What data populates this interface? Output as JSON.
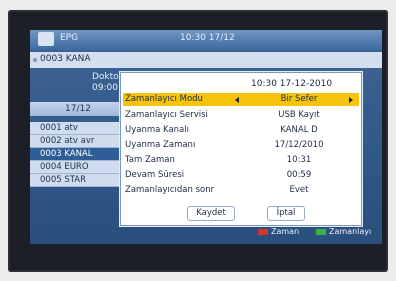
{
  "epg": {
    "title": "EPG",
    "time": "10:30 17/12",
    "event_text": "0003 KANA",
    "detail_line1": "Dokto",
    "detail_line2": "09:00",
    "date": "17/12",
    "channels": [
      {
        "label": "0001 atv",
        "selected": false
      },
      {
        "label": "0002 atv avr",
        "selected": false
      },
      {
        "label": "0003 KANAL",
        "selected": true
      },
      {
        "label": "0004 EURO",
        "selected": false
      },
      {
        "label": "0005 STAR",
        "selected": false
      }
    ],
    "legend": {
      "red_label": "Zaman",
      "green_label": "Zamanlayı",
      "red_color": "#d9342a",
      "green_color": "#39b34a"
    }
  },
  "timer_dialog": {
    "datetime": "10:30 17-12-2010",
    "rows": [
      {
        "label": "Zamanlayıcı Modu",
        "value": "Bir Sefer",
        "highlight": true
      },
      {
        "label": "Zamanlayıcı Servisi",
        "value": "USB Kayıt",
        "highlight": false
      },
      {
        "label": "Uyanma Kanalı",
        "value": "KANAL D",
        "highlight": false
      },
      {
        "label": "Uyanma Zamanı",
        "value": "17/12/2010",
        "highlight": false
      },
      {
        "label": "Tam Zaman",
        "value": "10:31",
        "highlight": false
      },
      {
        "label": "Devam Süresi",
        "value": "00:59",
        "highlight": false
      },
      {
        "label": "Zamanlayıcıdan sonr",
        "value": "Evet",
        "highlight": false
      }
    ],
    "buttons": {
      "save": "Kaydet",
      "cancel": "İptal"
    },
    "highlight_color": "#f6c40c"
  }
}
